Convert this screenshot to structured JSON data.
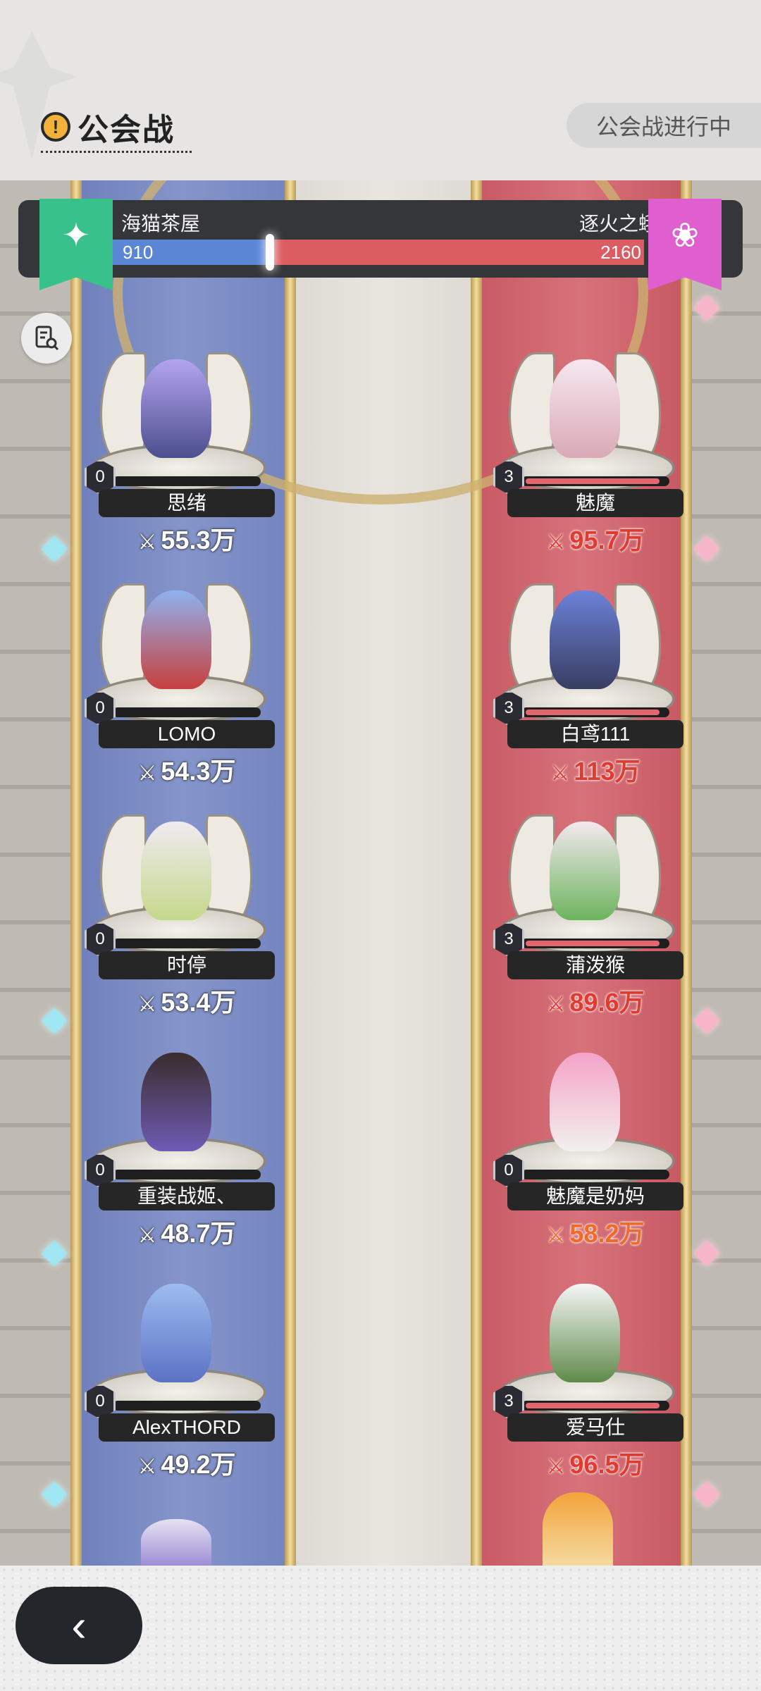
{
  "header": {
    "title": "公会战",
    "status": "公会战进行中"
  },
  "score": {
    "left_team": "海猫茶屋",
    "left_score": "910",
    "right_team": "逐火之蛾",
    "right_score": "2160",
    "left_fraction": 0.296
  },
  "colors": {
    "blue_lane": "#7f8fc6",
    "red_lane": "#d66b72",
    "left_banner": "#38c18a",
    "right_banner": "#e05fcf"
  },
  "icons": {
    "alert": "alert-icon",
    "battle_log": "battle-log-icon",
    "power": "crossed-swords-icon",
    "back": "back-chevron-icon"
  },
  "left_players": [
    {
      "name": "思绪",
      "power": "55.3万",
      "level": "0"
    },
    {
      "name": "LOMO",
      "power": "54.3万",
      "level": "0"
    },
    {
      "name": "时停",
      "power": "53.4万",
      "level": "0"
    },
    {
      "name": "重装战姬、",
      "power": "48.7万",
      "level": "0"
    },
    {
      "name": "AlexTHORD",
      "power": "49.2万",
      "level": "0"
    }
  ],
  "right_players": [
    {
      "name": "魅魔",
      "power": "95.7万",
      "level": "3"
    },
    {
      "name": "白鸢111",
      "power": "113万",
      "level": "3"
    },
    {
      "name": "蒲泼猴",
      "power": "89.6万",
      "level": "3"
    },
    {
      "name": "魅魔是奶妈",
      "power": "58.2万",
      "level": "0"
    },
    {
      "name": "爱马仕",
      "power": "96.5万",
      "level": "3"
    }
  ],
  "bottom": {
    "back_label": "‹"
  }
}
